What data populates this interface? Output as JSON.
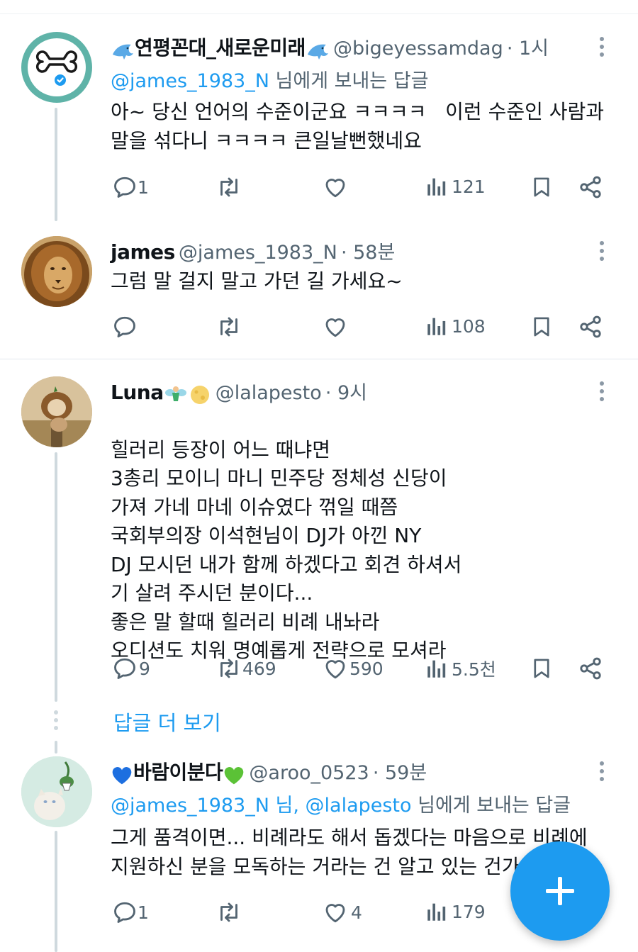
{
  "tweets": [
    {
      "display_name": "연평꼰대_새로운미래",
      "handle": "@bigeyessamdag",
      "time": "· 1시",
      "reply_prefix_link": "@james_1983_N",
      "reply_suffix": " 님에게 보내는 답글",
      "lines": [
        "아~ 당신 언어의 수준이군요 ㅋㅋㅋㅋ   이런 수준인 사람과",
        "말을 섞다니 ㅋㅋㅋㅋ 큰일날뻔했네요"
      ],
      "replies": "1",
      "retweets": "",
      "likes": "",
      "views": "121"
    },
    {
      "display_name": "james",
      "handle": "@james_1983_N",
      "time": "· 58분",
      "lines": [
        "그럼 말 걸지 말고 가던 길 가세요~"
      ],
      "replies": "",
      "retweets": "",
      "likes": "",
      "views": "108"
    },
    {
      "display_name": "Luna",
      "handle": "@lalapesto",
      "time": "· 9시",
      "lines": [
        "힐러리 등장이 어느 때냐면",
        "3총리 모이니 마니 민주당 정체성 신당이",
        "가져 가네 마네 이슈였다 꺾일 때쯤",
        "국회부의장 이석현님이 DJ가 아낀 NY",
        "DJ 모시던 내가 함께 하겠다고 회견 하셔서",
        "기 살려 주시던 분이다...",
        "좋은 말 할때 힐러리 비례 내놔라",
        "오디션도 치워 명예롭게 전략으로 모셔라"
      ],
      "replies": "9",
      "retweets": "469",
      "likes": "590",
      "views": "5.5천"
    },
    {
      "display_name": "바람이분다",
      "handle": "@aroo_0523",
      "time": "· 59분",
      "reply_prefix_link": "@james_1983_N 님, @lalapesto",
      "reply_suffix": " 님에게 보내는 답글",
      "lines": [
        "그게 품격이면... 비례라도 해서 돕겠다는 마음으로 비례에",
        "지원하신 분을 모독하는 거라는 건 알고 있는 건가"
      ],
      "replies": "1",
      "retweets": "",
      "likes": "4",
      "views": "179"
    }
  ],
  "show_more_replies": "답글 더 보기",
  "colors": {
    "accent": "#1d9bf0",
    "text": "#0f1419",
    "muted": "#536471"
  },
  "icons": [
    "dolphin-emoji",
    "verified-badge",
    "bone-avatar",
    "fairy-emoji",
    "moon-emoji",
    "blue-heart-emoji",
    "green-heart-emoji",
    "reply-icon",
    "retweet-icon",
    "like-icon",
    "views-icon",
    "bookmark-icon",
    "share-icon",
    "more-icon",
    "compose-plus-icon"
  ]
}
